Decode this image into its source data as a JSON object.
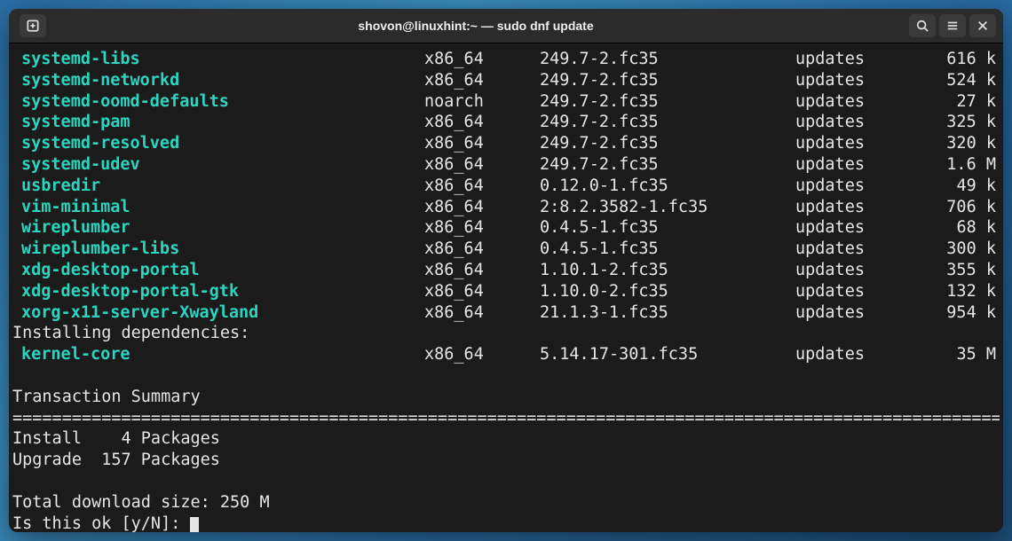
{
  "window": {
    "title": "shovon@linuxhint:~ — sudo dnf update"
  },
  "packages": [
    {
      "name": "systemd-libs",
      "arch": "x86_64",
      "version": "249.7-2.fc35",
      "repo": "updates",
      "size": "616 k"
    },
    {
      "name": "systemd-networkd",
      "arch": "x86_64",
      "version": "249.7-2.fc35",
      "repo": "updates",
      "size": "524 k"
    },
    {
      "name": "systemd-oomd-defaults",
      "arch": "noarch",
      "version": "249.7-2.fc35",
      "repo": "updates",
      "size": "27 k"
    },
    {
      "name": "systemd-pam",
      "arch": "x86_64",
      "version": "249.7-2.fc35",
      "repo": "updates",
      "size": "325 k"
    },
    {
      "name": "systemd-resolved",
      "arch": "x86_64",
      "version": "249.7-2.fc35",
      "repo": "updates",
      "size": "320 k"
    },
    {
      "name": "systemd-udev",
      "arch": "x86_64",
      "version": "249.7-2.fc35",
      "repo": "updates",
      "size": "1.6 M"
    },
    {
      "name": "usbredir",
      "arch": "x86_64",
      "version": "0.12.0-1.fc35",
      "repo": "updates",
      "size": "49 k"
    },
    {
      "name": "vim-minimal",
      "arch": "x86_64",
      "version": "2:8.2.3582-1.fc35",
      "repo": "updates",
      "size": "706 k"
    },
    {
      "name": "wireplumber",
      "arch": "x86_64",
      "version": "0.4.5-1.fc35",
      "repo": "updates",
      "size": "68 k"
    },
    {
      "name": "wireplumber-libs",
      "arch": "x86_64",
      "version": "0.4.5-1.fc35",
      "repo": "updates",
      "size": "300 k"
    },
    {
      "name": "xdg-desktop-portal",
      "arch": "x86_64",
      "version": "1.10.1-2.fc35",
      "repo": "updates",
      "size": "355 k"
    },
    {
      "name": "xdg-desktop-portal-gtk",
      "arch": "x86_64",
      "version": "1.10.0-2.fc35",
      "repo": "updates",
      "size": "132 k"
    },
    {
      "name": "xorg-x11-server-Xwayland",
      "arch": "x86_64",
      "version": "21.1.3-1.fc35",
      "repo": "updates",
      "size": "954 k"
    }
  ],
  "deps_header": "Installing dependencies:",
  "deps": [
    {
      "name": "kernel-core",
      "arch": "x86_64",
      "version": "5.14.17-301.fc35",
      "repo": "updates",
      "size": "35 M"
    }
  ],
  "summary": {
    "header": "Transaction Summary",
    "install_line": "Install    4 Packages",
    "upgrade_line": "Upgrade  157 Packages",
    "total_line": "Total download size: 250 M",
    "prompt": "Is this ok [y/N]: "
  }
}
